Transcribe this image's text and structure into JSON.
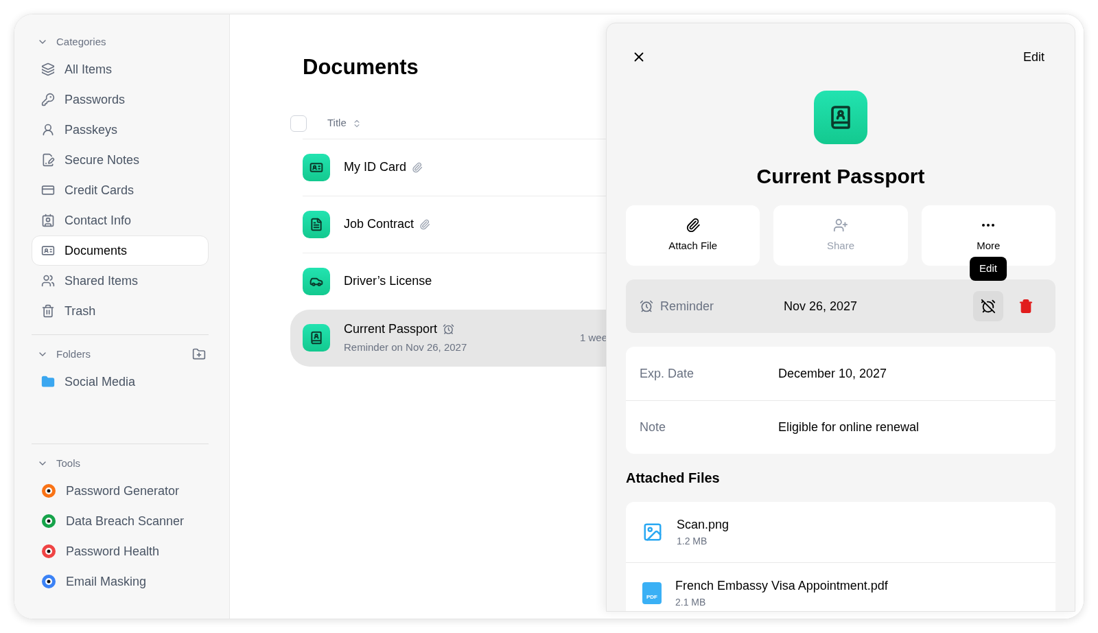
{
  "sidebar": {
    "sections": [
      {
        "title": "Categories",
        "expanded": true,
        "action": false,
        "items": [
          {
            "label": "All Items",
            "selected": false
          },
          {
            "label": "Passwords",
            "selected": false
          },
          {
            "label": "Passkeys",
            "selected": false
          },
          {
            "label": "Secure Notes",
            "selected": false
          },
          {
            "label": "Credit Cards",
            "selected": false
          },
          {
            "label": "Contact Info",
            "selected": false
          },
          {
            "label": "Documents",
            "selected": true
          },
          {
            "label": "Shared Items",
            "selected": false
          },
          {
            "label": "Trash",
            "selected": false
          }
        ]
      },
      {
        "title": "Folders",
        "expanded": true,
        "action": true,
        "items": [
          {
            "label": "Social Media",
            "selected": false
          }
        ]
      },
      {
        "title": "Tools",
        "expanded": true,
        "action": false,
        "items": [
          {
            "label": "Password Generator",
            "selected": false
          },
          {
            "label": "Data Breach Scanner",
            "selected": false
          },
          {
            "label": "Password Health",
            "selected": false
          },
          {
            "label": "Email Masking",
            "selected": false
          }
        ]
      }
    ]
  },
  "list": {
    "title": "Documents",
    "column": "Title",
    "all_checked": false,
    "rows": [
      {
        "title": "My ID Card",
        "attachment": true,
        "reminder": false,
        "selected": false
      },
      {
        "title": "Job Contract",
        "attachment": true,
        "reminder": false,
        "selected": false
      },
      {
        "title": "Driver’s License",
        "attachment": false,
        "reminder": false,
        "selected": false
      },
      {
        "title": "Current Passport",
        "attachment": false,
        "reminder": true,
        "subtitle": "Reminder on Nov 26, 2027",
        "time": "1 wee",
        "selected": true
      }
    ]
  },
  "detail": {
    "edit": "Edit",
    "title": "Current Passport",
    "actions": [
      {
        "label": "Attach File",
        "disabled": false
      },
      {
        "label": "Share",
        "disabled": true
      },
      {
        "label": "More",
        "disabled": false
      }
    ],
    "tooltip": "Edit",
    "reminder": {
      "label": "Reminder",
      "value": "Nov 26, 2027"
    },
    "fields": [
      {
        "label": "Exp. Date",
        "value": "December 10, 2027"
      },
      {
        "label": "Note",
        "value": "Eligible for online renewal"
      }
    ],
    "files_title": "Attached Files",
    "files": [
      {
        "name": "Scan.png",
        "size": "1.2 MB",
        "kind": "image"
      },
      {
        "name": "French Embassy Visa Appointment.pdf",
        "size": "2.1 MB",
        "kind": "pdf",
        "badge": "PDF"
      }
    ]
  }
}
